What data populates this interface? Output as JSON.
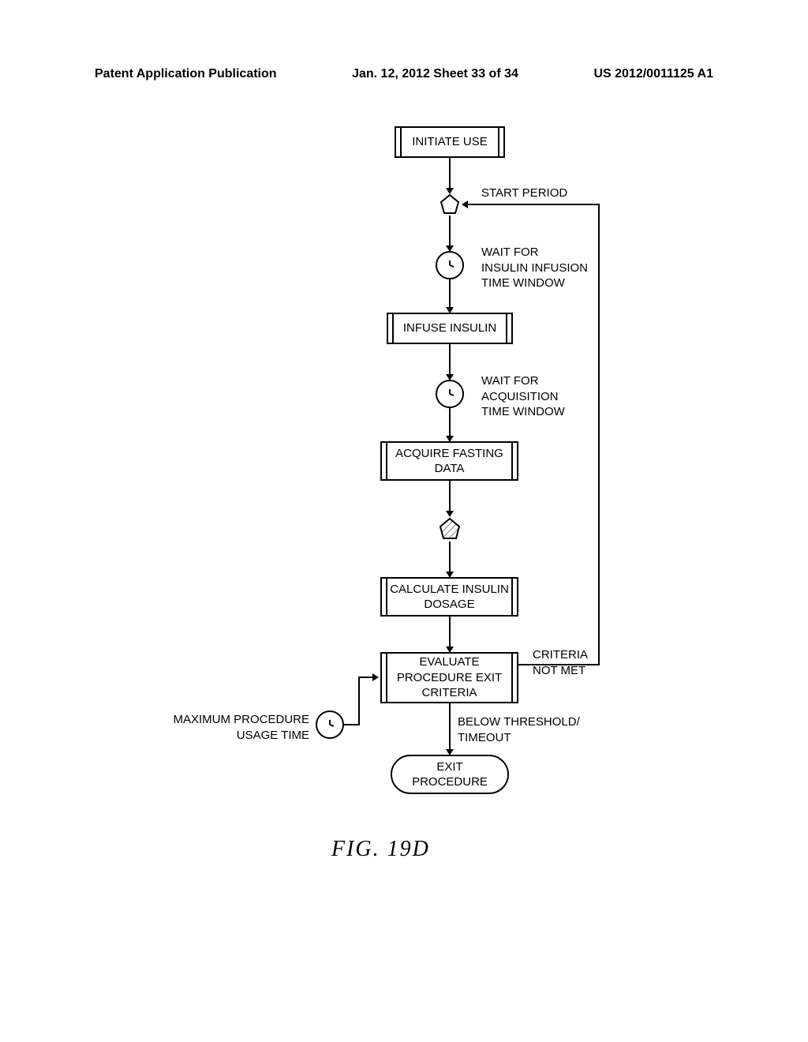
{
  "header": {
    "left": "Patent Application Publication",
    "middle": "Jan. 12, 2012  Sheet 33 of 34",
    "right": "US 2012/0011125 A1"
  },
  "nodes": {
    "initiate": "INITIATE USE",
    "start_period": "START PERIOD",
    "wait_infusion": "WAIT FOR\nINSULIN INFUSION\nTIME WINDOW",
    "infuse": "INFUSE INSULIN",
    "wait_acquisition": "WAIT FOR\nACQUISITION\nTIME WINDOW",
    "acquire": "ACQUIRE FASTING\nDATA",
    "calculate": "CALCULATE INSULIN\nDOSAGE",
    "evaluate": "EVALUATE\nPROCEDURE EXIT\nCRITERIA",
    "exit": "EXIT\nPROCEDURE"
  },
  "labels": {
    "criteria_not_met": "CRITERIA\nNOT MET",
    "below_threshold": "BELOW THRESHOLD/\nTIMEOUT",
    "max_usage": "MAXIMUM PROCEDURE\nUSAGE TIME"
  },
  "figure": "FIG. 19D",
  "chart_data": {
    "type": "flowchart",
    "nodes": [
      {
        "id": "initiate",
        "type": "process",
        "label": "INITIATE USE"
      },
      {
        "id": "start_period",
        "type": "connector",
        "label": "START PERIOD"
      },
      {
        "id": "wait_infusion",
        "type": "wait",
        "label": "WAIT FOR INSULIN INFUSION TIME WINDOW"
      },
      {
        "id": "infuse",
        "type": "process",
        "label": "INFUSE INSULIN"
      },
      {
        "id": "wait_acquisition",
        "type": "wait",
        "label": "WAIT FOR ACQUISITION TIME WINDOW"
      },
      {
        "id": "acquire",
        "type": "process",
        "label": "ACQUIRE FASTING DATA"
      },
      {
        "id": "marker",
        "type": "connector"
      },
      {
        "id": "calculate",
        "type": "process",
        "label": "CALCULATE INSULIN DOSAGE"
      },
      {
        "id": "evaluate",
        "type": "process",
        "label": "EVALUATE PROCEDURE EXIT CRITERIA"
      },
      {
        "id": "exit",
        "type": "terminator",
        "label": "EXIT PROCEDURE"
      },
      {
        "id": "max_usage",
        "type": "wait",
        "label": "MAXIMUM PROCEDURE USAGE TIME"
      }
    ],
    "edges": [
      {
        "from": "initiate",
        "to": "start_period"
      },
      {
        "from": "start_period",
        "to": "wait_infusion"
      },
      {
        "from": "wait_infusion",
        "to": "infuse"
      },
      {
        "from": "infuse",
        "to": "wait_acquisition"
      },
      {
        "from": "wait_acquisition",
        "to": "acquire"
      },
      {
        "from": "acquire",
        "to": "marker"
      },
      {
        "from": "marker",
        "to": "calculate"
      },
      {
        "from": "calculate",
        "to": "evaluate"
      },
      {
        "from": "evaluate",
        "to": "exit",
        "label": "BELOW THRESHOLD/TIMEOUT"
      },
      {
        "from": "evaluate",
        "to": "start_period",
        "label": "CRITERIA NOT MET"
      },
      {
        "from": "max_usage",
        "to": "evaluate"
      }
    ]
  }
}
